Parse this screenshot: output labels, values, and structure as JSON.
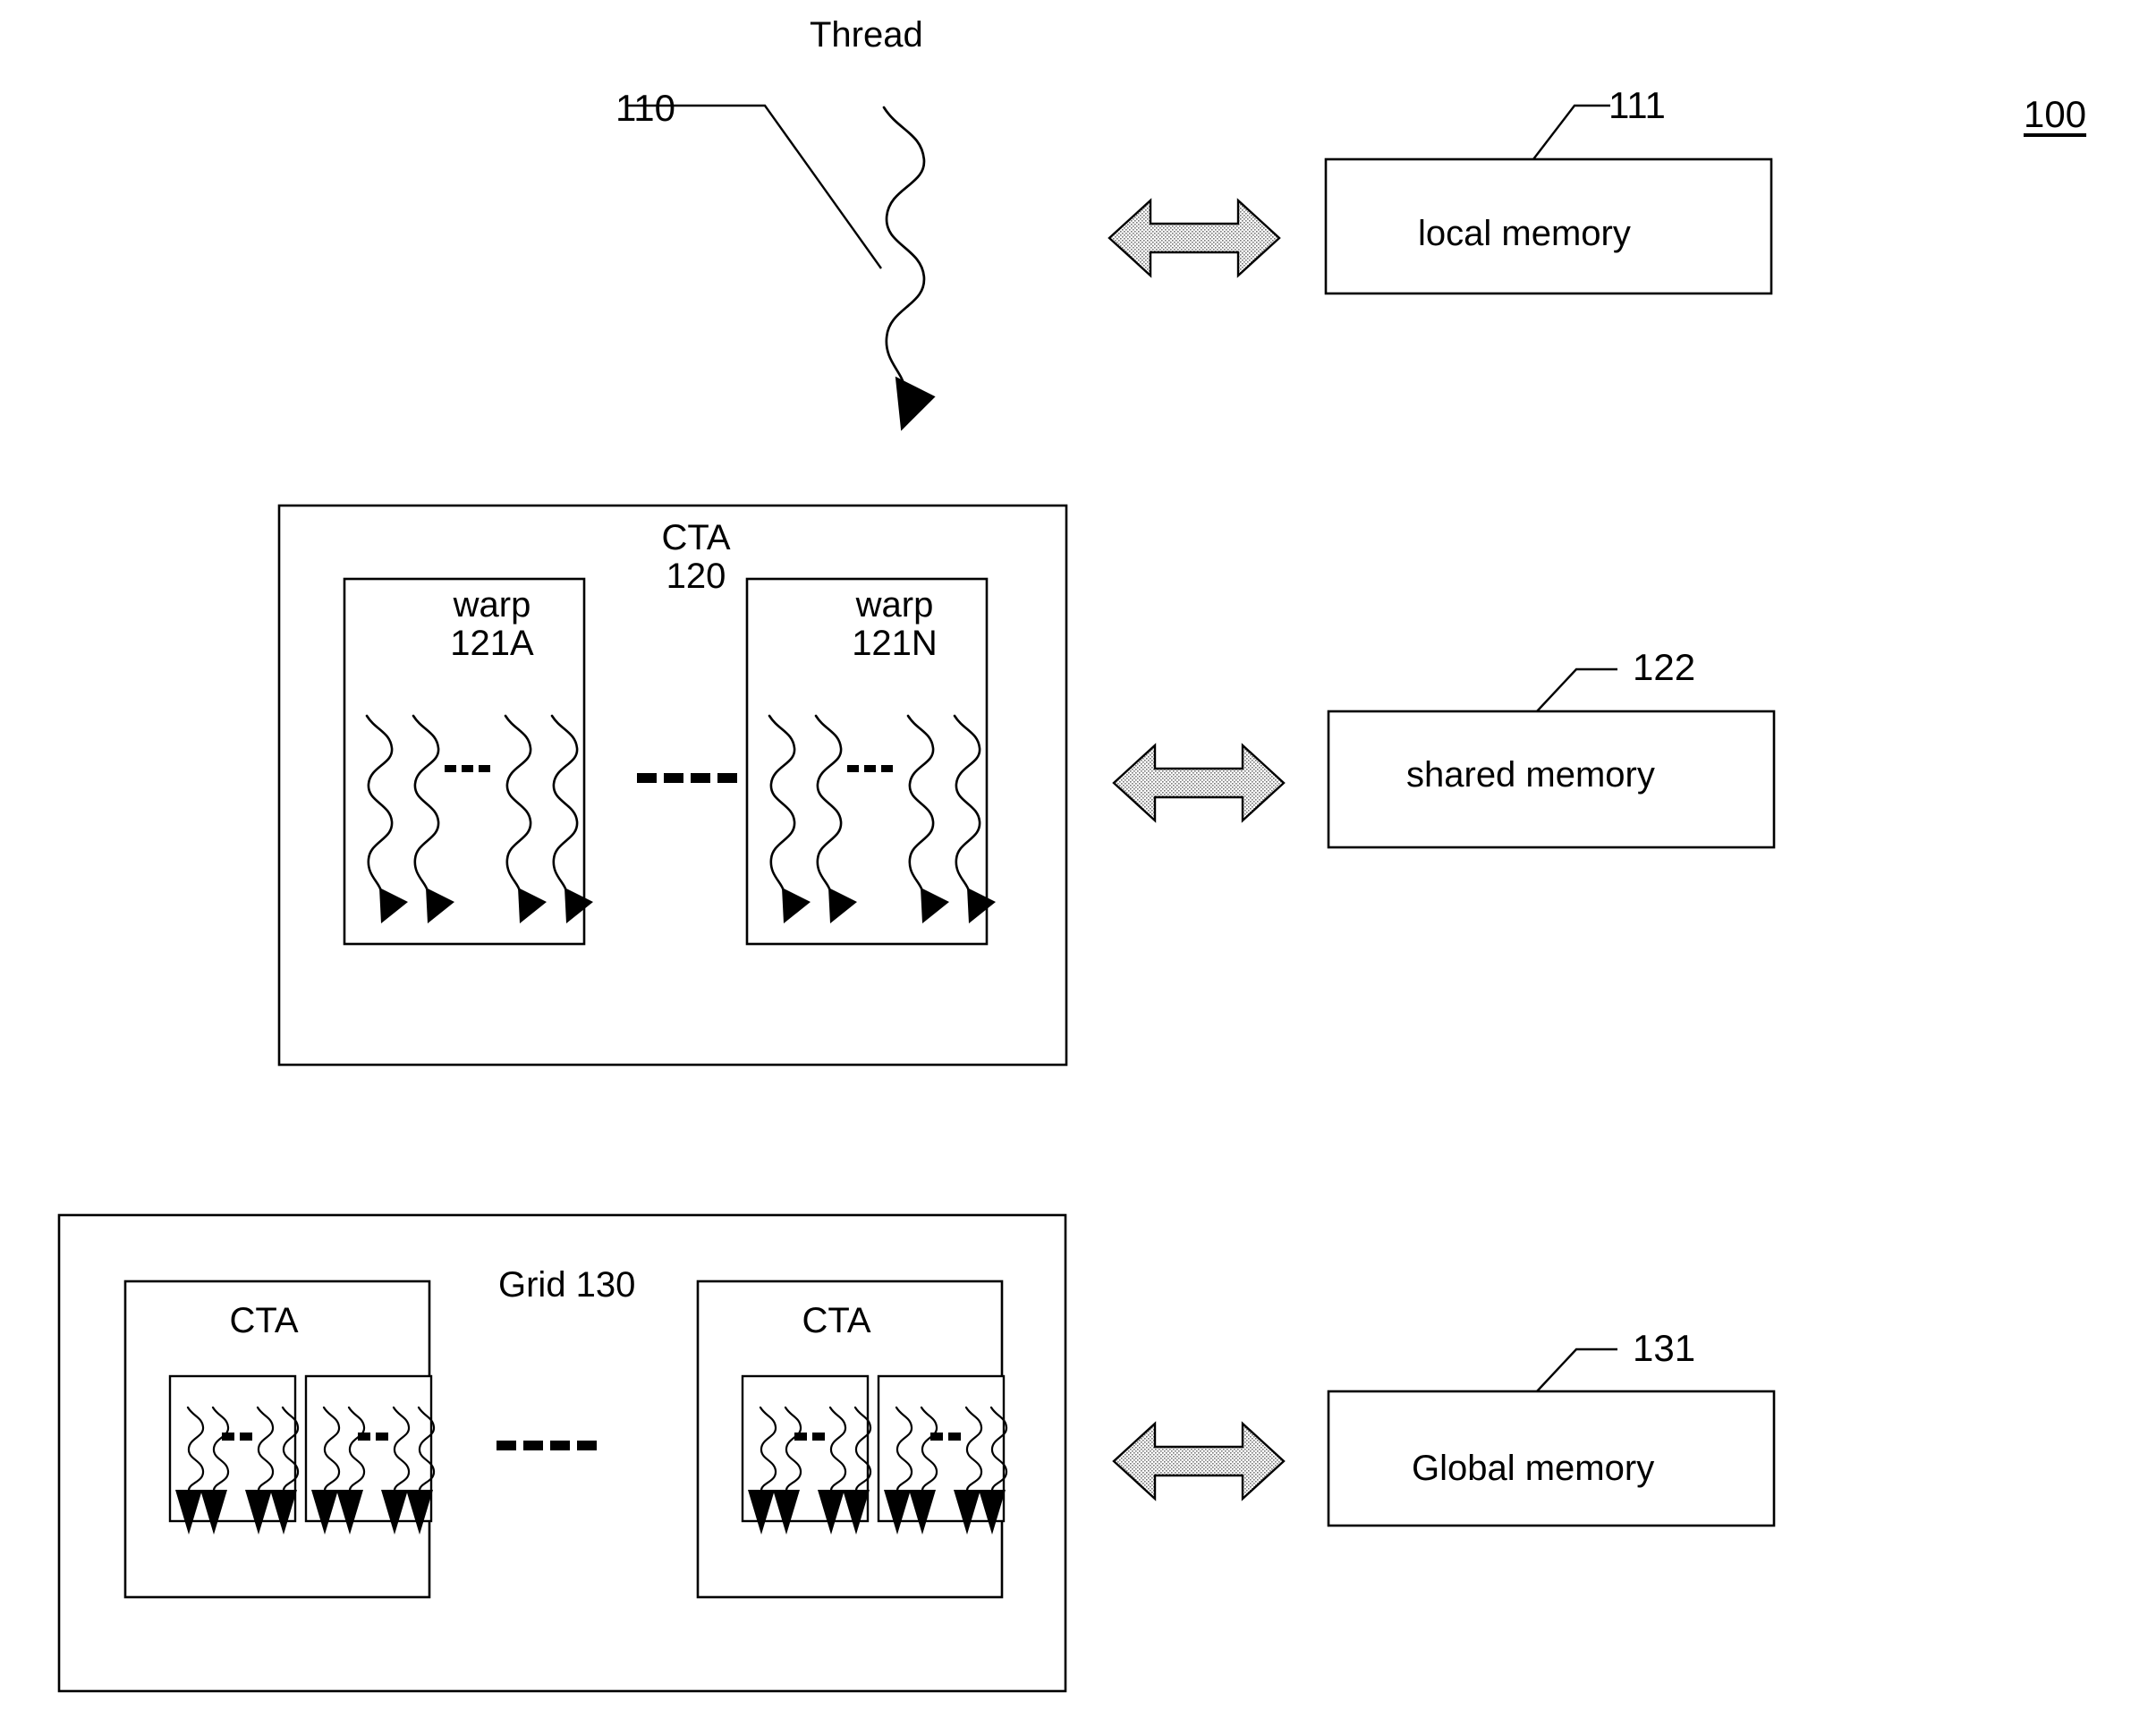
{
  "figure": {
    "number": "100",
    "type": "patent-diagram",
    "title_visible": false
  },
  "colors": {
    "line": "#000000",
    "background": "#ffffff",
    "arrow_fill": "#d8d8d8",
    "arrow_stroke": "#000000",
    "arrowhead_fill": "#000000"
  },
  "thread_row": {
    "thread_label": "Thread",
    "ref_number": "110",
    "memory_ref": "111",
    "memory_label": "local memory"
  },
  "cta_row": {
    "cta_label": "CTA",
    "cta_ref": "120",
    "warps": [
      {
        "name": "warp",
        "ref": "121A",
        "thread_count": 4
      },
      {
        "name": "warp",
        "ref": "121N",
        "thread_count": 4
      }
    ],
    "ellipsis_between_warps": "- - - - -",
    "ellipsis_in_warp": "- - - - -",
    "memory_ref": "122",
    "memory_label": "shared memory"
  },
  "grid_row": {
    "grid_label": "Grid 130",
    "ctas": [
      {
        "label": "CTA",
        "warp_count": 2
      },
      {
        "label": "CTA",
        "warp_count": 2
      }
    ],
    "ellipsis_between_ctas": "- - - - -",
    "memory_ref": "131",
    "memory_label": "Global memory"
  },
  "icons": {
    "bidirectional_arrow": "double-headed-arrow",
    "thread_squiggle": "wavy-thread-line",
    "thread_arrowhead": "solid-triangle-arrowhead"
  }
}
